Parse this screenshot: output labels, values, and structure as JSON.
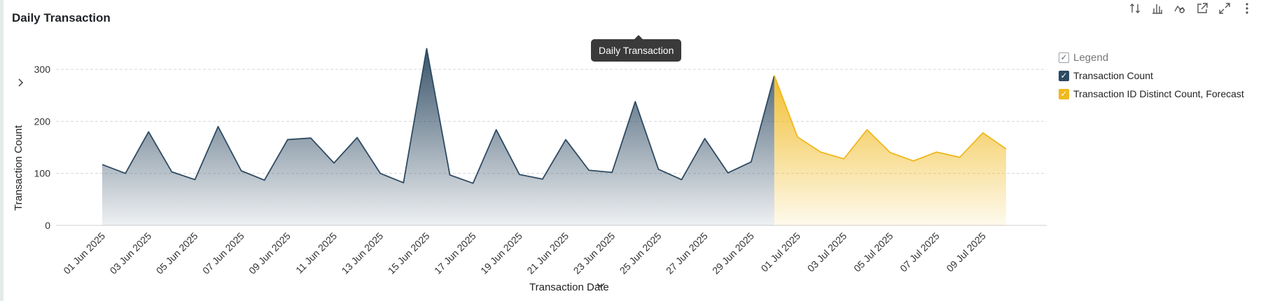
{
  "title": "Daily Transaction",
  "tooltip": "Daily Transaction",
  "toolbar": [
    "sort-icon",
    "bar-chart-icon",
    "chart-type-icon",
    "export-icon",
    "expand-icon",
    "more-icon"
  ],
  "legend": {
    "header": "Legend",
    "items": [
      {
        "label": "Transaction Count",
        "color": "#2e4a62"
      },
      {
        "label": "Transaction ID Distinct Count, Forecast",
        "color": "#f0b81c"
      }
    ]
  },
  "chart_data": {
    "type": "area",
    "xlabel": "Transaction Date",
    "ylabel": "Transaction Count",
    "ylim": [
      0,
      350
    ],
    "yticks": [
      0,
      100,
      200,
      300
    ],
    "grid": true,
    "legend_position": "right",
    "x_tick_labels": [
      "01 Jun 2025",
      "03 Jun 2025",
      "05 Jun 2025",
      "07 Jun 2025",
      "09 Jun 2025",
      "11 Jun 2025",
      "13 Jun 2025",
      "15 Jun 2025",
      "17 Jun 2025",
      "19 Jun 2025",
      "21 Jun 2025",
      "23 Jun 2025",
      "25 Jun 2025",
      "27 Jun 2025",
      "29 Jun 2025",
      "01 Jul 2025",
      "03 Jul 2025",
      "05 Jul 2025",
      "07 Jul 2025",
      "09 Jul 2025"
    ],
    "series": [
      {
        "name": "Transaction Count",
        "color": "#2e4a62",
        "x": [
          "01 Jun 2025",
          "02 Jun 2025",
          "03 Jun 2025",
          "04 Jun 2025",
          "05 Jun 2025",
          "06 Jun 2025",
          "07 Jun 2025",
          "08 Jun 2025",
          "09 Jun 2025",
          "10 Jun 2025",
          "11 Jun 2025",
          "12 Jun 2025",
          "13 Jun 2025",
          "14 Jun 2025",
          "15 Jun 2025",
          "16 Jun 2025",
          "17 Jun 2025",
          "18 Jun 2025",
          "19 Jun 2025",
          "20 Jun 2025",
          "21 Jun 2025",
          "22 Jun 2025",
          "23 Jun 2025",
          "24 Jun 2025",
          "25 Jun 2025",
          "26 Jun 2025",
          "27 Jun 2025",
          "28 Jun 2025",
          "29 Jun 2025",
          "30 Jun 2025"
        ],
        "values": [
          117,
          100,
          180,
          103,
          88,
          190,
          105,
          87,
          165,
          168,
          120,
          169,
          100,
          82,
          340,
          97,
          81,
          184,
          98,
          89,
          165,
          106,
          102,
          238,
          108,
          88,
          167,
          101,
          122,
          288
        ]
      },
      {
        "name": "Transaction ID Distinct Count, Forecast",
        "color": "#f0b81c",
        "x": [
          "30 Jun 2025",
          "01 Jul 2025",
          "02 Jul 2025",
          "03 Jul 2025",
          "04 Jul 2025",
          "05 Jul 2025",
          "06 Jul 2025",
          "07 Jul 2025",
          "08 Jul 2025",
          "09 Jul 2025",
          "10 Jul 2025"
        ],
        "values": [
          288,
          170,
          141,
          128,
          184,
          140,
          124,
          141,
          131,
          178,
          147
        ]
      }
    ]
  }
}
